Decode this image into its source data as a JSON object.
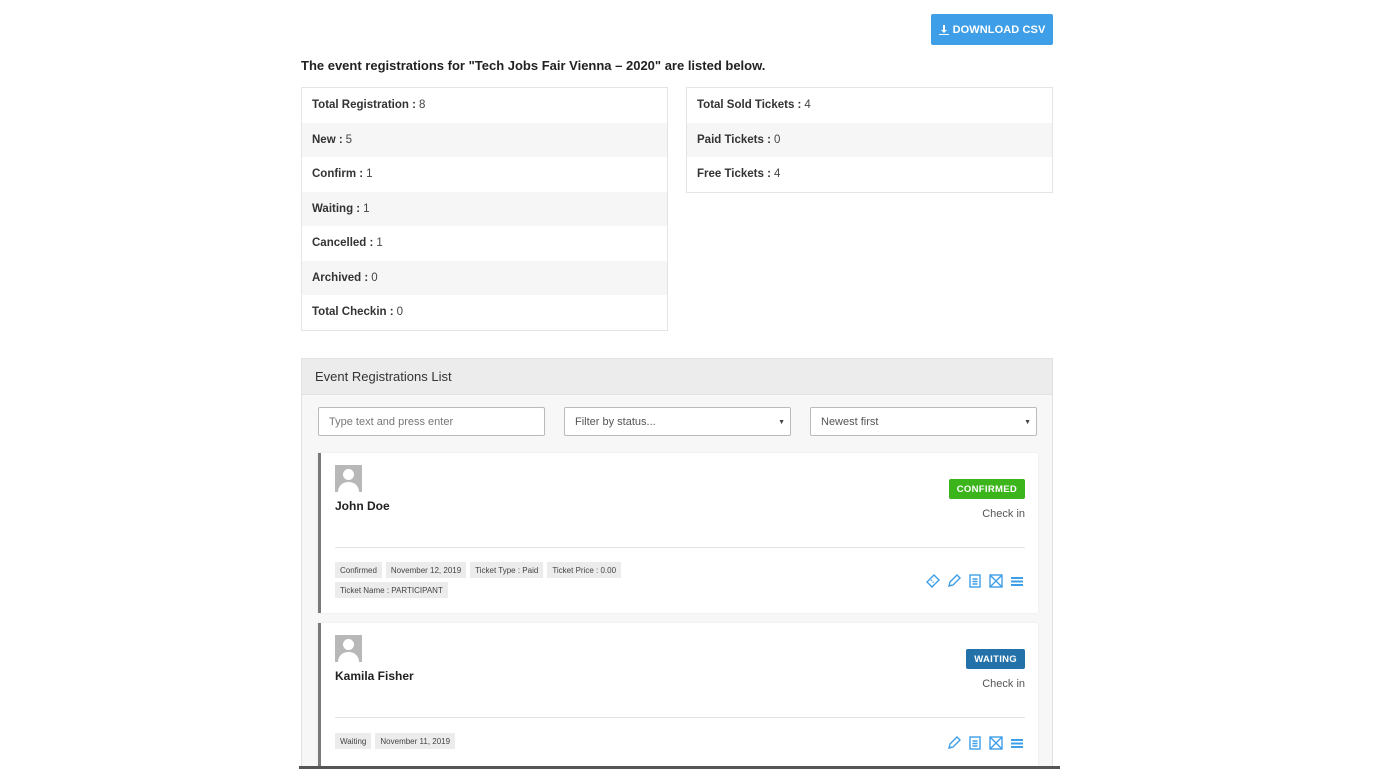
{
  "toolbar": {
    "download_label": "DOWNLOAD CSV"
  },
  "intro": "The event registrations for \"Tech Jobs Fair Vienna – 2020\" are listed below.",
  "stats_left": [
    {
      "label": "Total Registration :",
      "value": "8"
    },
    {
      "label": "New :",
      "value": "5"
    },
    {
      "label": "Confirm :",
      "value": "1"
    },
    {
      "label": "Waiting :",
      "value": "1"
    },
    {
      "label": "Cancelled :",
      "value": "1"
    },
    {
      "label": "Archived :",
      "value": "0"
    },
    {
      "label": "Total Checkin :",
      "value": "0"
    }
  ],
  "stats_right": [
    {
      "label": "Total Sold Tickets :",
      "value": "4"
    },
    {
      "label": "Paid Tickets :",
      "value": "0"
    },
    {
      "label": "Free Tickets :",
      "value": "4"
    }
  ],
  "panel": {
    "title": "Event Registrations List",
    "search_placeholder": "Type text and press enter",
    "status_filter": "Filter by status...",
    "sort_filter": "Newest first"
  },
  "registrations": [
    {
      "name": "John Doe",
      "status": "CONFIRMED",
      "checkin": "Check in",
      "tags": [
        "Confirmed",
        "November 12, 2019",
        "Ticket Type : Paid",
        "Ticket Price : 0.00",
        "Ticket Name : PARTICIPANT"
      ]
    },
    {
      "name": "Kamila Fisher",
      "status": "WAITING",
      "checkin": "Check in",
      "tags": [
        "Waiting",
        "November 11, 2019"
      ]
    }
  ],
  "colors": {
    "accent": "#3e9fe8",
    "confirmed": "#3cb41b",
    "waiting": "#2271a8",
    "icon": "#3e9fe8"
  }
}
